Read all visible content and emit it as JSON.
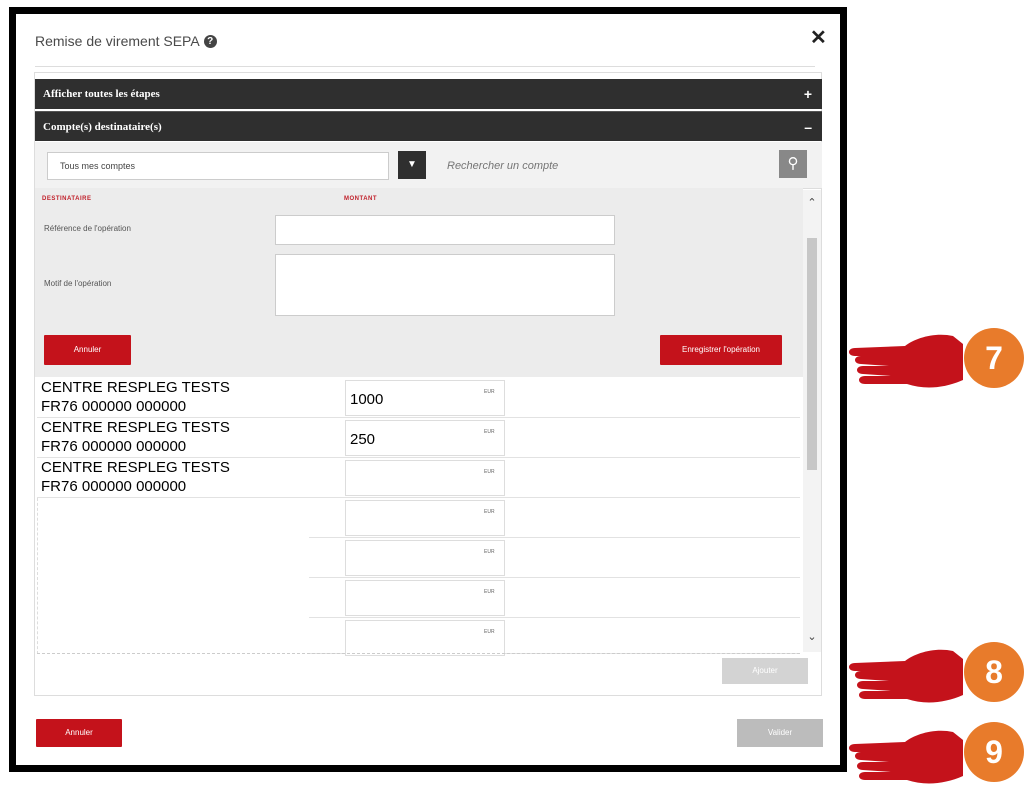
{
  "dialog": {
    "title": "Remise de virement SEPA",
    "help_glyph": "?",
    "close_glyph": "✕"
  },
  "accordions": [
    {
      "label": "Afficher toutes les étapes",
      "toggle": "+"
    },
    {
      "label": "Compte(s) destinataire(s)",
      "toggle": "–"
    }
  ],
  "filter": {
    "account_selected": "Tous mes comptes",
    "search_placeholder": "Rechercher un compte"
  },
  "form": {
    "col_destinataire": "DESTINATAIRE",
    "col_montant": "MONTANT",
    "ref_label": "Référence de l'opération",
    "motif_label": "Motif de l'opération",
    "cancel_label": "Annuler",
    "save_label": "Enregistrer l'opération"
  },
  "rows": [
    {
      "name": "CENTRE RESPLEG TESTS",
      "iban": "FR76 000000 000000",
      "amount": "1000",
      "currency": "EUR"
    },
    {
      "name": "CENTRE RESPLEG TESTS",
      "iban": "FR76 000000 000000",
      "amount": "250",
      "currency": "EUR"
    },
    {
      "name": "CENTRE RESPLEG TESTS",
      "iban": "FR76 000000 000000",
      "amount": "",
      "currency": "EUR"
    }
  ],
  "empty_rows": [
    {
      "currency": "EUR"
    },
    {
      "currency": "EUR"
    },
    {
      "currency": "EUR"
    },
    {
      "currency": "EUR"
    }
  ],
  "footer": {
    "add_label": "Ajouter",
    "cancel_label": "Annuler",
    "validate_label": "Valider"
  },
  "callouts": [
    {
      "number": "7"
    },
    {
      "number": "8"
    },
    {
      "number": "9"
    }
  ],
  "colors": {
    "accent_red": "#c4121b",
    "header_dark": "#2f2f2f",
    "badge_orange": "#e87b2b"
  }
}
